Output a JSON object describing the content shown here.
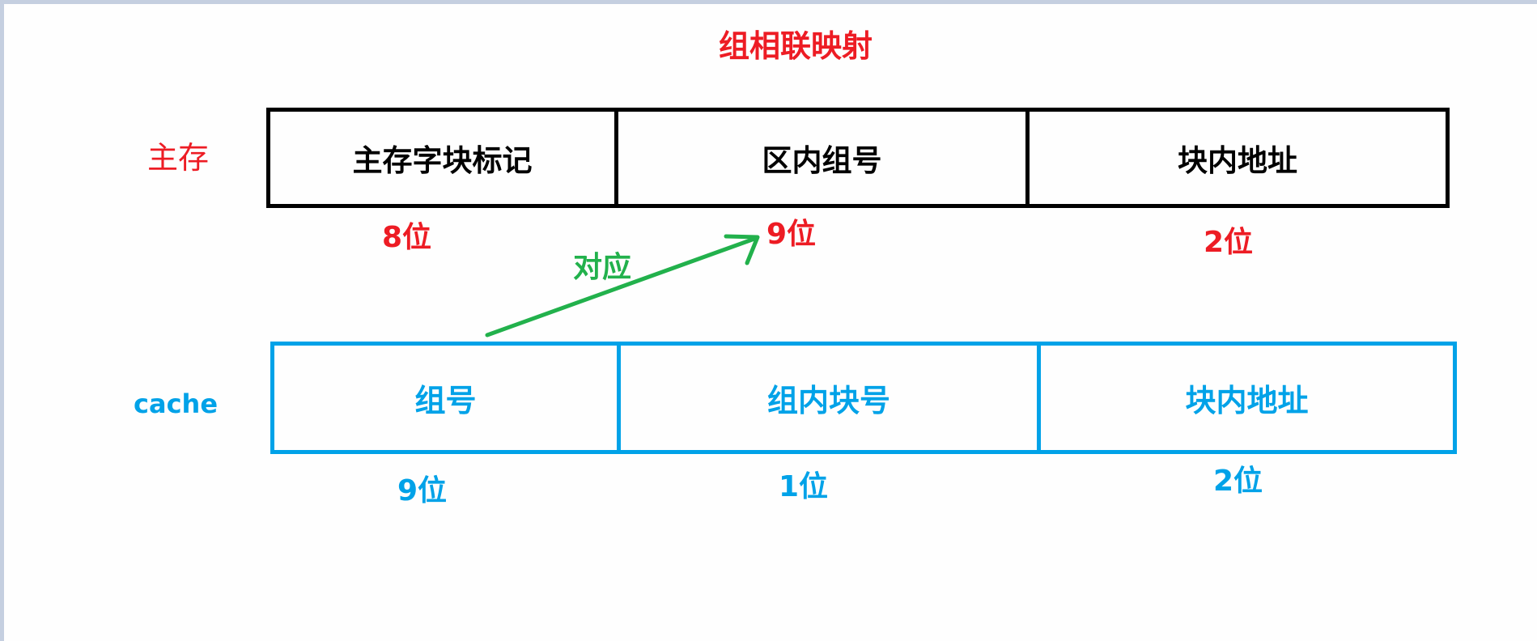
{
  "title": "组相联映射",
  "colors": {
    "main_memory": "#ed1c24",
    "cache": "#00a2e8",
    "arrow": "#22b14c",
    "main_box_border": "#000000"
  },
  "main_memory": {
    "label": "主存",
    "fields": [
      {
        "name": "主存字块标记",
        "bits": "8位"
      },
      {
        "name": "区内组号",
        "bits": "9位"
      },
      {
        "name": "块内地址",
        "bits": "2位"
      }
    ]
  },
  "cache": {
    "label": "cache",
    "fields": [
      {
        "name": "组号",
        "bits": "9位"
      },
      {
        "name": "组内块号",
        "bits": "1位"
      },
      {
        "name": "块内地址",
        "bits": "2位"
      }
    ]
  },
  "correspondence": {
    "label": "对应",
    "from": "cache.组号",
    "to": "main_memory.区内组号",
    "icon": "arrow-icon"
  }
}
